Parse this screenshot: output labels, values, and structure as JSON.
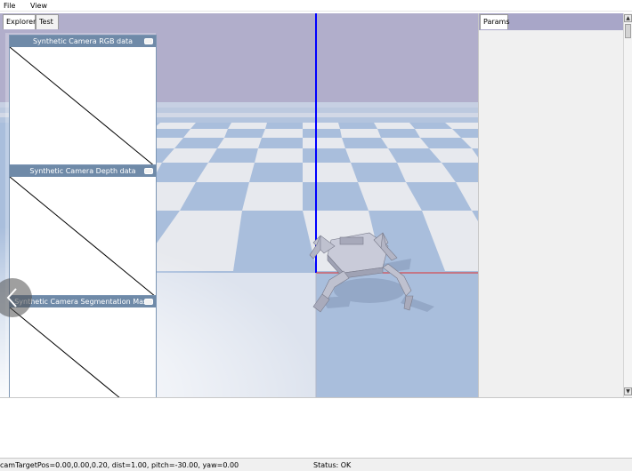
{
  "menu": {
    "file_label": "File",
    "view_label": "View"
  },
  "tabs": {
    "explorer_label": "Explorer",
    "test_label": "Test",
    "params_label": "Params"
  },
  "camera_windows": {
    "rgb_title": "Synthetic Camera RGB data",
    "depth_title": "Synthetic Camera Depth data",
    "segmentation_title": "Synthetic Camera Segmentation Mask"
  },
  "statusbar": {
    "camera_info": "camTargetPos=0.00,0.00,0.20, dist=1.00, pitch=-30.00, yaw=0.00",
    "status": "Status: OK"
  },
  "colors": {
    "sky": "#b1aecb",
    "floor_light": "#e7e9ee",
    "floor_dark": "#a9bedc",
    "axis_blue": "#0000ff",
    "axis_red": "#e03030",
    "panel_title": "#6f8aa8"
  },
  "icons": {
    "nav": "chevron-left-icon",
    "minimize": "minimize-icon",
    "scroll_up": "scroll-up-arrow-icon",
    "scroll_down": "scroll-down-arrow-icon"
  }
}
